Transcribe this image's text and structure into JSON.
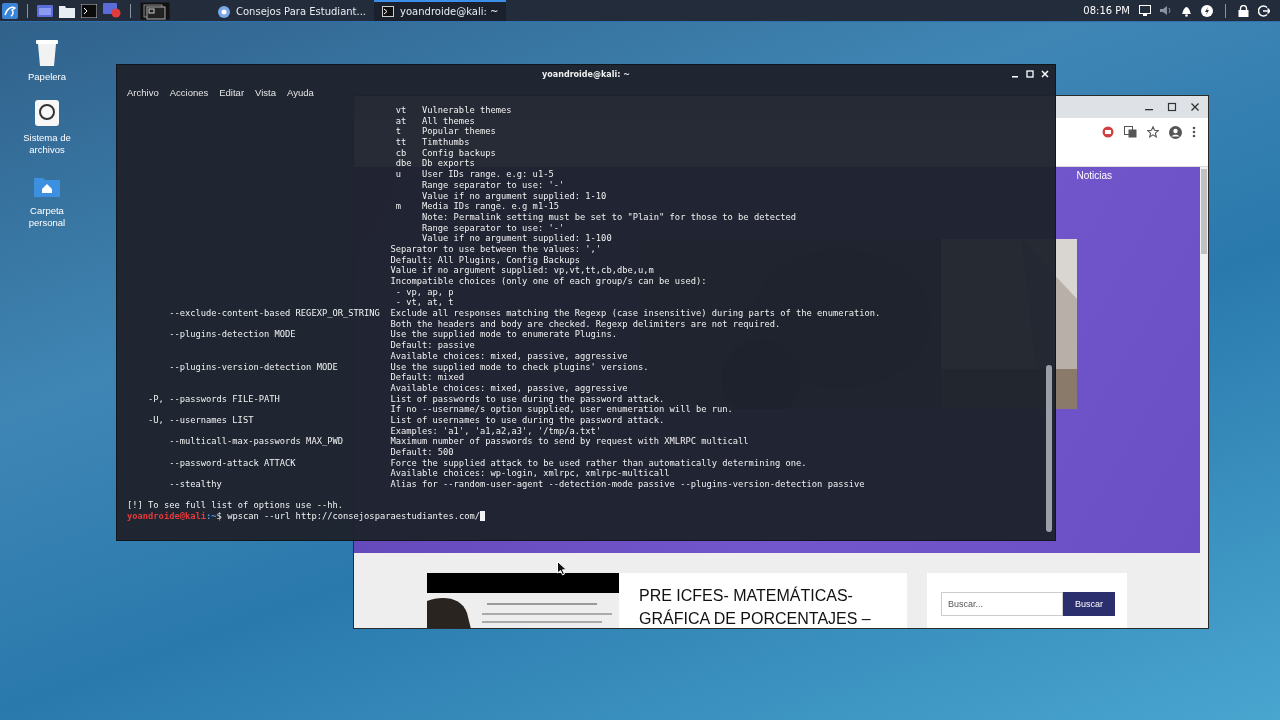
{
  "taskbar": {
    "tasks": [
      {
        "label": "Consejos Para Estudiant...",
        "kind": "browser",
        "selected": false
      },
      {
        "label": "yoandroide@kali: ~",
        "kind": "terminal",
        "selected": true
      }
    ],
    "clock": "08:16 PM"
  },
  "desktop_icons": [
    {
      "label": "Papelera",
      "kind": "trash"
    },
    {
      "label": "Sistema de archivos",
      "kind": "drive"
    },
    {
      "label": "Carpeta personal",
      "kind": "home"
    }
  ],
  "terminal": {
    "title": "yoandroide@kali: ~",
    "menu": [
      "Archivo",
      "Acciones",
      "Editar",
      "Vista",
      "Ayuda"
    ],
    "lines": [
      {
        "kind": "value",
        "term": "vt",
        "text": "Vulnerable themes"
      },
      {
        "kind": "value",
        "term": "at",
        "text": "All themes"
      },
      {
        "kind": "value",
        "term": "t",
        "text": "Popular themes"
      },
      {
        "kind": "value",
        "term": "tt",
        "text": "Timthumbs"
      },
      {
        "kind": "value",
        "term": "cb",
        "text": "Config backups"
      },
      {
        "kind": "value",
        "term": "dbe",
        "text": "Db exports"
      },
      {
        "kind": "value",
        "term": "u",
        "text": "User IDs range. e.g: u1-5"
      },
      {
        "kind": "value",
        "text": "Range separator to use: '-'"
      },
      {
        "kind": "value",
        "text": "Value if no argument supplied: 1-10"
      },
      {
        "kind": "value",
        "term": "m",
        "text": "Media IDs range. e.g m1-15"
      },
      {
        "kind": "value",
        "text": "Note: Permalink setting must be set to \"Plain\" for those to be detected"
      },
      {
        "kind": "value",
        "text": "Range separator to use: '-'"
      },
      {
        "kind": "value",
        "text": "Value if no argument supplied: 1-100"
      },
      {
        "kind": "desc",
        "text": "Separator to use between the values: ','"
      },
      {
        "kind": "desc",
        "text": "Default: All Plugins, Config Backups"
      },
      {
        "kind": "desc",
        "text": "Value if no argument supplied: vp,vt,tt,cb,dbe,u,m"
      },
      {
        "kind": "desc",
        "text": "Incompatible choices (only one of each group/s can be used):"
      },
      {
        "kind": "item",
        "text": "- vp, ap, p"
      },
      {
        "kind": "item",
        "text": "- vt, at, t"
      },
      {
        "kind": "long",
        "term": "--exclude-content-based REGEXP_OR_STRING",
        "text": "Exclude all responses matching the Regexp (case insensitive) during parts of the enumeration."
      },
      {
        "kind": "desc",
        "text": "Both the headers and body are checked. Regexp delimiters are not required."
      },
      {
        "kind": "long",
        "term": "--plugins-detection MODE",
        "text": "Use the supplied mode to enumerate Plugins."
      },
      {
        "kind": "desc",
        "text": "Default: passive"
      },
      {
        "kind": "desc",
        "text": "Available choices: mixed, passive, aggressive"
      },
      {
        "kind": "long",
        "term": "--plugins-version-detection MODE",
        "text": "Use the supplied mode to check plugins' versions."
      },
      {
        "kind": "desc",
        "text": "Default: mixed"
      },
      {
        "kind": "desc",
        "text": "Available choices: mixed, passive, aggressive"
      },
      {
        "kind": "short",
        "term": "-P, --passwords FILE-PATH",
        "text": "List of passwords to use during the password attack."
      },
      {
        "kind": "desc",
        "text": "If no --username/s option supplied, user enumeration will be run."
      },
      {
        "kind": "short",
        "term": "-U, --usernames LIST",
        "text": "List of usernames to use during the password attack."
      },
      {
        "kind": "desc",
        "text": "Examples: 'a1', 'a1,a2,a3', '/tmp/a.txt'"
      },
      {
        "kind": "long",
        "term": "--multicall-max-passwords MAX_PWD",
        "text": "Maximum number of passwords to send by request with XMLRPC multicall"
      },
      {
        "kind": "desc",
        "text": "Default: 500"
      },
      {
        "kind": "long",
        "term": "--password-attack ATTACK",
        "text": "Force the supplied attack to be used rather than automatically determining one."
      },
      {
        "kind": "desc",
        "text": "Available choices: wp-login, xmlrpc, xmlrpc-multicall"
      },
      {
        "kind": "long",
        "term": "--stealthy",
        "text": "Alias for --random-user-agent --detection-mode passive --plugins-version-detection passive"
      }
    ],
    "notice": "[!] To see full list of options use --hh.",
    "prompt": {
      "user": "yoandroide@kali",
      "path": ":~",
      "symbol": "$",
      "command": "wpscan --url http://consejosparaestudiantes.com/"
    }
  },
  "browser": {
    "nav": [
      "Noticias"
    ],
    "post": {
      "title": "PRE ICFES- MATEMÁTICAS- GRÁFICA DE PORCENTAJES –"
    },
    "search": {
      "placeholder": "Buscar...",
      "button": "Buscar"
    }
  }
}
